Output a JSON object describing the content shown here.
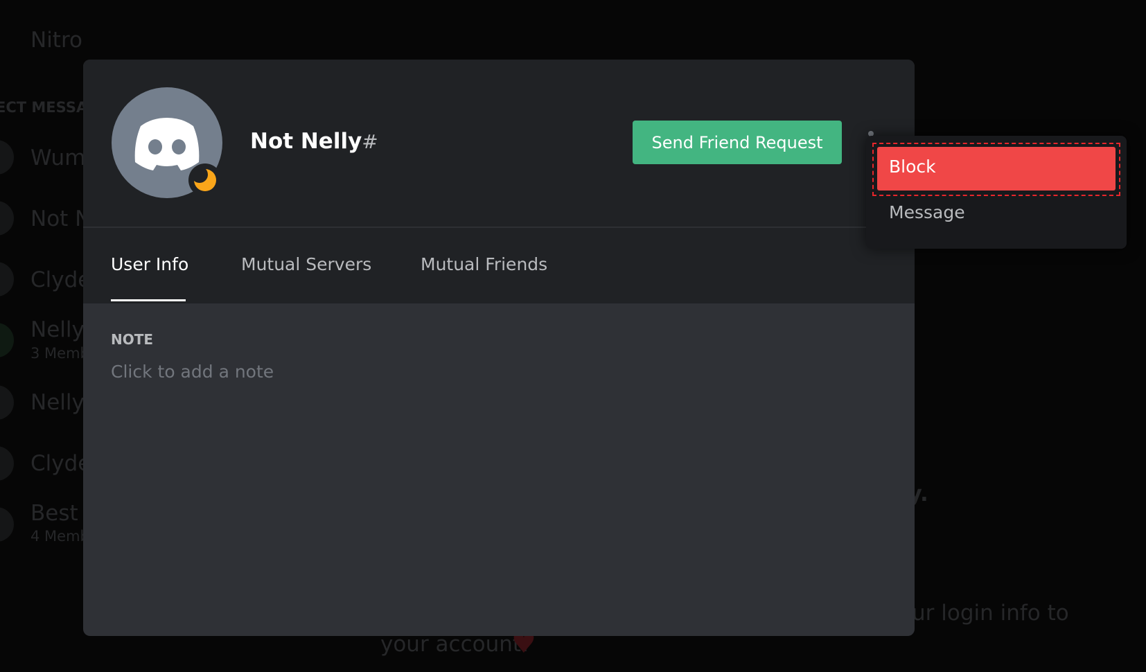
{
  "background": {
    "nitro": "Nitro",
    "dm_header": "ECT MESSA",
    "dm_list": [
      {
        "name": "Wum"
      },
      {
        "name": "Not N"
      },
      {
        "name": "Clyde"
      },
      {
        "name": "Nelly,",
        "sub": "3 Memb"
      },
      {
        "name": "Nelly"
      },
      {
        "name": "Clyde"
      },
      {
        "name": "Best B",
        "sub": "4 Memb"
      }
    ],
    "text1": "ly.",
    "text2": "ur login info to",
    "text3": "your account!"
  },
  "profile": {
    "username": "Not Nelly",
    "discriminator": "#",
    "status": "idle",
    "send_friend_request": "Send Friend Request",
    "tabs": [
      {
        "label": "User Info",
        "active": true
      },
      {
        "label": "Mutual Servers"
      },
      {
        "label": "Mutual Friends"
      }
    ],
    "note_label": "NOTE",
    "note_placeholder": "Click to add a note"
  },
  "menu": {
    "items": [
      {
        "label": "Block"
      },
      {
        "label": "Message"
      }
    ]
  },
  "colors": {
    "accent_green": "#43b581",
    "danger": "#f04747",
    "idle": "#faa61a"
  }
}
